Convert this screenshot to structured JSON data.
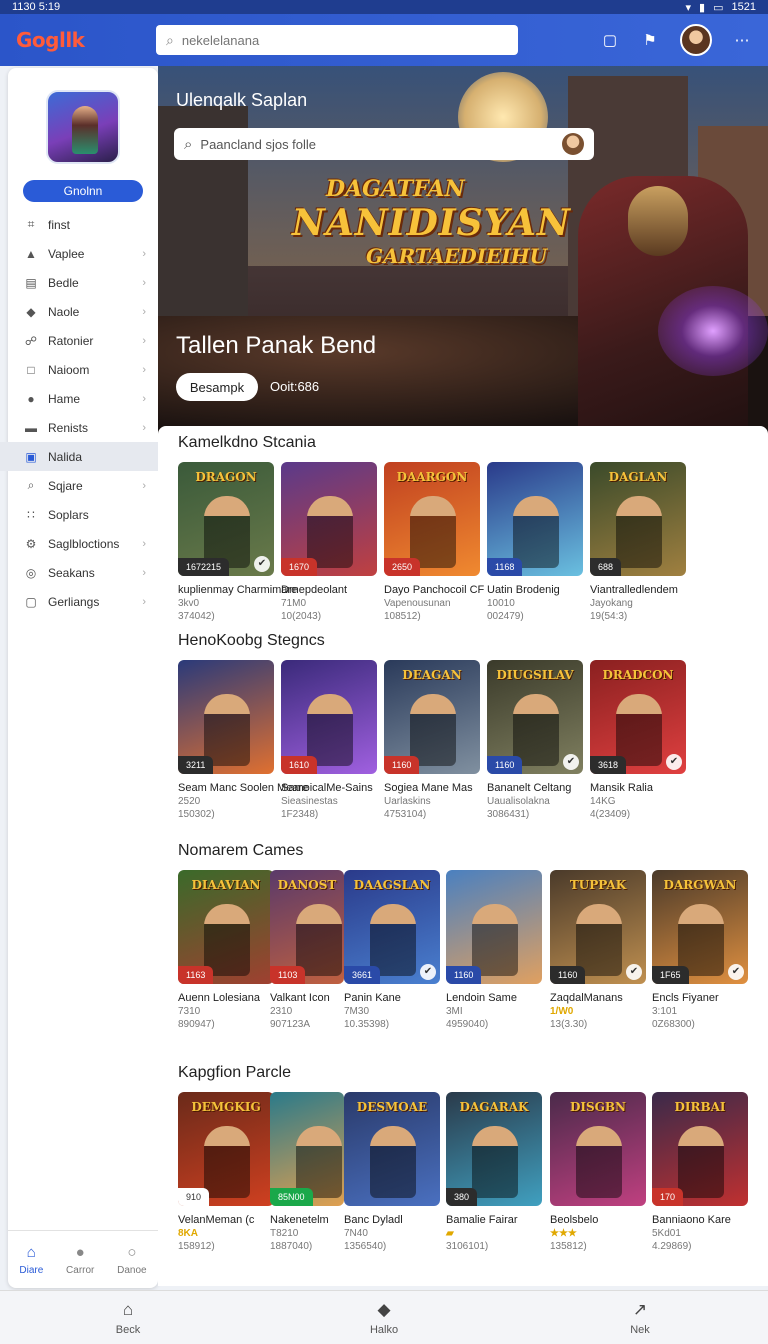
{
  "status": {
    "time": "1130 5:19",
    "right": "1521"
  },
  "topbar": {
    "logo": "Gogllk",
    "search_placeholder": "nekelelanana"
  },
  "sidebar": {
    "open_label": "Gnolnn",
    "items": [
      {
        "label": "finst",
        "icon": "grid-icon",
        "chevron": false
      },
      {
        "label": "Vaplee",
        "icon": "triangle-icon",
        "chevron": true
      },
      {
        "label": "Bedle",
        "icon": "layers-icon",
        "chevron": true
      },
      {
        "label": "Naole",
        "icon": "shield-icon",
        "chevron": true
      },
      {
        "label": "Ratonier",
        "icon": "link-icon",
        "chevron": true
      },
      {
        "label": "Naioom",
        "icon": "square-icon",
        "chevron": true
      },
      {
        "label": "Hame",
        "icon": "user-icon",
        "chevron": true
      },
      {
        "label": "Renists",
        "icon": "card-icon",
        "chevron": true
      },
      {
        "label": "Nalida",
        "icon": "book-icon",
        "chevron": false,
        "active": true
      },
      {
        "label": "Sqjare",
        "icon": "search-icon",
        "chevron": true
      },
      {
        "label": "Soplars",
        "icon": "grid-dots-icon",
        "chevron": false
      },
      {
        "label": "Saglbloctions",
        "icon": "gear-icon",
        "chevron": true
      },
      {
        "label": "Seakans",
        "icon": "compass-icon",
        "chevron": true
      },
      {
        "label": "Gerliangs",
        "icon": "window-icon",
        "chevron": true
      }
    ],
    "bottom": [
      {
        "label": "Diare",
        "icon": "home-icon",
        "active": true
      },
      {
        "label": "Carror",
        "icon": "chat-icon",
        "active": false
      },
      {
        "label": "Danoe",
        "icon": "person-icon",
        "active": false
      }
    ]
  },
  "hero": {
    "heading": "Ulenqalk Saplan",
    "search_text": "Paancland sjos folle",
    "logo_l1": "DAGATFAN",
    "logo_l2": "NANIDISYAN",
    "logo_l3": "GARTAEDIEIHU",
    "title": "Tallen Panak Bend",
    "button": "Besampk",
    "meta": "Ooit:686"
  },
  "sections": [
    {
      "title": "Kamelkdno Stcania",
      "cards": [
        {
          "art": "DRAGON",
          "tag": "1672215",
          "tagc": "#2c2c2c",
          "badge": true,
          "name": "kuplienmay Charmimare",
          "sub": "3kv0",
          "count": "374042)",
          "c1": "#3a5a3a",
          "c2": "#6a7a4a"
        },
        {
          "art": "",
          "tag": "1670",
          "tagc": "#c8332a",
          "badge": false,
          "name": "Drnepdeolant",
          "sub": "71M0",
          "count": "10(2043)",
          "c1": "#5a3a8a",
          "c2": "#c04040"
        },
        {
          "art": "DAARGON",
          "tag": "2650",
          "tagc": "#c8332a",
          "badge": false,
          "name": "Dayo Panchocoil CF",
          "sub": "Vapenousunan",
          "count": "108512)",
          "c1": "#c04020",
          "c2": "#f08a30"
        },
        {
          "art": "",
          "tag": "1168",
          "tagc": "#2a4aa8",
          "badge": false,
          "name": "Uatin Brodenig",
          "sub": "10010",
          "count": "002479)",
          "c1": "#2a3a8a",
          "c2": "#6ac0e0"
        },
        {
          "art": "DAGLAN",
          "tag": "688",
          "tagc": "#2c2c2c",
          "badge": false,
          "name": "Viantralledlendem",
          "sub": "Jayokang",
          "count": "19(54:3)",
          "c1": "#3a4a2a",
          "c2": "#a08040"
        }
      ]
    },
    {
      "title": "HenoKoobg Stegncs",
      "cards": [
        {
          "art": "",
          "tag": "3211",
          "tagc": "#2c2c2c",
          "badge": false,
          "name": "Seam Manc Soolen Meare",
          "sub": "2520",
          "count": "150302)",
          "c1": "#2a3a7a",
          "c2": "#e07030"
        },
        {
          "art": "",
          "tag": "1610",
          "tagc": "#c8332a",
          "badge": false,
          "name": "SamoicalMe-Sains",
          "sub": "Sieasinestas",
          "count": "1F2348)",
          "c1": "#3a2a7a",
          "c2": "#a060e0"
        },
        {
          "art": "DEAGAN",
          "tag": "1160",
          "tagc": "#c8332a",
          "badge": false,
          "name": "Sogiea Mane Mas",
          "sub": "Uarlaskins",
          "count": "4753104)",
          "c1": "#2a3a5a",
          "c2": "#8090a0"
        },
        {
          "art": "DIUGSILAV",
          "tag": "1160",
          "tagc": "#2a4aa8",
          "badge": true,
          "name": "Bananelt Celtang",
          "sub": "Uaualisolakna",
          "count": "3086431)",
          "c1": "#3a3a2a",
          "c2": "#808060"
        },
        {
          "art": "DRADCON",
          "tag": "3618",
          "tagc": "#2c2c2c",
          "badge": true,
          "name": "Mansik Ralia",
          "sub": "14KG",
          "count": "4(23409)",
          "c1": "#8a2020",
          "c2": "#e04040"
        }
      ]
    },
    {
      "title": "Nomarem Cames",
      "cards": [
        {
          "art": "DIAAVIAN",
          "tag": "1163",
          "tagc": "#c8332a",
          "badge": false,
          "name": "Auenn Lolesiana",
          "sub": "7310",
          "count": "890947)",
          "c1": "#3a6a2a",
          "c2": "#a04030"
        },
        {
          "art": "DANOST",
          "tag": "1103",
          "tagc": "#c8332a",
          "badge": false,
          "name": "Valkant Icon",
          "sub": "2310",
          "count": "907123A",
          "c1": "#5a3a6a",
          "c2": "#c06040"
        },
        {
          "art": "DAAGSLAN",
          "tag": "3661",
          "tagc": "#2a4aa8",
          "badge": true,
          "name": "Panin Kane",
          "sub": "7M30",
          "count": "10.35398)",
          "c1": "#2a3a8a",
          "c2": "#4a80d0"
        },
        {
          "art": "",
          "tag": "1160",
          "tagc": "#2a4aa8",
          "badge": false,
          "name": "Lendoin Same",
          "sub": "3MI",
          "count": "4959040)",
          "c1": "#4a80c0",
          "c2": "#e0a060"
        },
        {
          "art": "TUPPAK",
          "tag": "1160",
          "tagc": "#2c2c2c",
          "badge": true,
          "name": "ZaqdalManans",
          "sub": "1/W0",
          "subgold": true,
          "count": "13(3.30)",
          "c1": "#4a3a2a",
          "c2": "#c09050"
        },
        {
          "art": "DARGWAN",
          "tag": "1F65",
          "tagc": "#2c2c2c",
          "badge": true,
          "name": "Encls Fiyaner",
          "sub": "3:101",
          "count": "0Z68300)",
          "c1": "#4a3a2a",
          "c2": "#e09040"
        }
      ]
    },
    {
      "title": "Kapgfion Parcle",
      "cards": [
        {
          "art": "DEMGKIG",
          "tag": "910",
          "tagc": "#ffffff",
          "badge": false,
          "name": "VelanMeman (c",
          "sub": "8KA",
          "subgold": true,
          "count": "158912)",
          "c1": "#6a2a1a",
          "c2": "#d04020"
        },
        {
          "art": "",
          "tag": "85N00",
          "tagc": "#1aa84a",
          "badge": false,
          "name": "Nakenetelm",
          "sub": "T8210",
          "count": "1887040)",
          "c1": "#2a7a8a",
          "c2": "#e0a050"
        },
        {
          "art": "DESMOAE",
          "tag": "",
          "tagc": "#2c2c2c",
          "badge": false,
          "name": "Banc Dyladl",
          "sub": "7N40",
          "count": "1356540)",
          "c1": "#2a3a6a",
          "c2": "#4a70c0"
        },
        {
          "art": "DAGARAK",
          "tag": "380",
          "tagc": "#2c2c2c",
          "badge": false,
          "name": "Bamalie Fairar",
          "sub": "▰",
          "subgold": true,
          "count": "3106101)",
          "c1": "#2a3a4a",
          "c2": "#40a0c0"
        },
        {
          "art": "DISGBN",
          "tag": "",
          "tagc": "#2c2c2c",
          "badge": false,
          "name": "Beolsbelo",
          "sub": "★★★",
          "subgold": true,
          "count": "135812)",
          "c1": "#4a2a4a",
          "c2": "#c04080"
        },
        {
          "art": "DIRBAI",
          "tag": "170",
          "tagc": "#c8332a",
          "badge": false,
          "name": "Banniaono Kare",
          "sub": "5Kd01",
          "count": "4.29869)",
          "c1": "#3a2a4a",
          "c2": "#c03030"
        }
      ]
    }
  ],
  "bottomnav": [
    {
      "label": "Beck",
      "icon": "home-icon"
    },
    {
      "label": "Halko",
      "icon": "shield-icon"
    },
    {
      "label": "Nek",
      "icon": "share-icon"
    }
  ],
  "colors": {
    "primary": "#2a5bd7",
    "topbar": "#2b55c9",
    "hero_logo": "#f7c23a"
  }
}
